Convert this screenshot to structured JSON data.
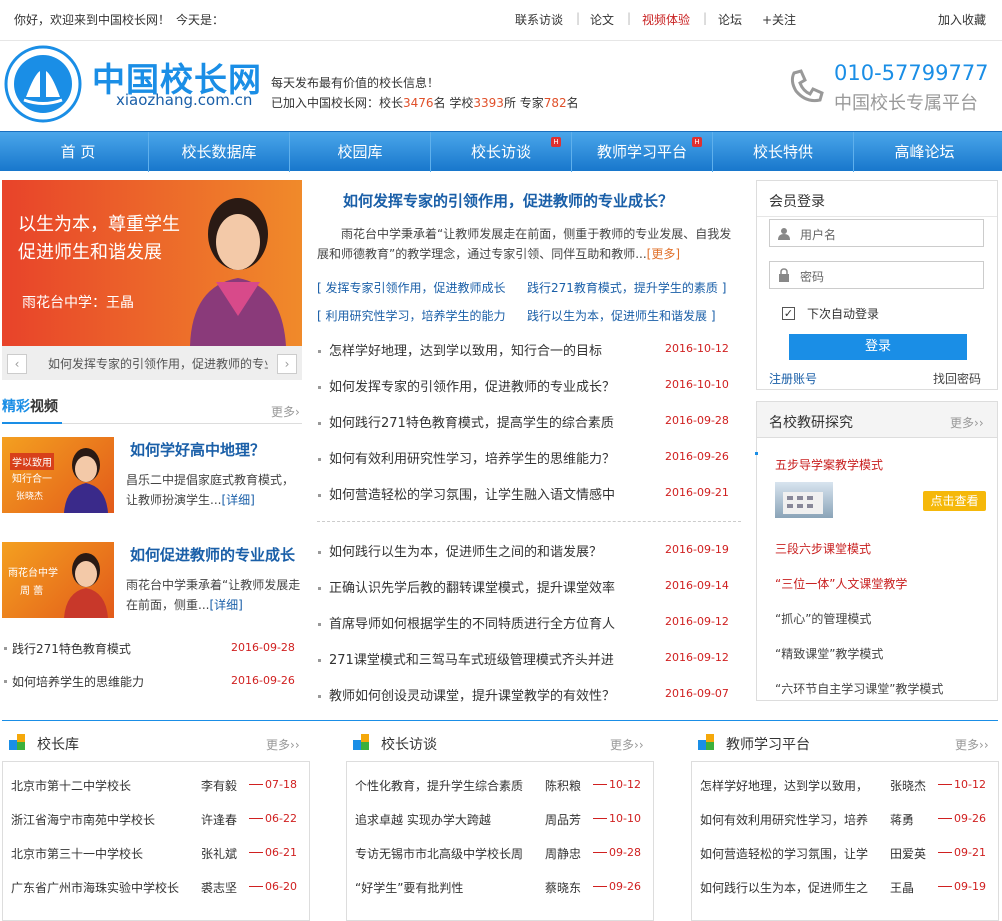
{
  "topbar": {
    "greeting": "你好，欢迎来到中国校长网！",
    "today": "今天是：",
    "links": [
      "联系访谈",
      "论文",
      "视频体验",
      "论坛"
    ],
    "follow": "+关注",
    "bookmark": "加入收藏"
  },
  "header": {
    "logo_cn": "中国校长网",
    "logo_en": "xiaozhang.com.cn",
    "seal_text": "中国校长网",
    "tagline": "每天发布最有价值的校长信息！",
    "stats_prefix": "已加入中国校长网：校长",
    "principals": "3476",
    "stats_mid1": "名 学校",
    "schools": "3393",
    "stats_mid2": "所 专家",
    "experts": "782",
    "stats_suffix": "名",
    "phone": "010-57799777",
    "platform": "中国校长专属平台"
  },
  "nav": [
    {
      "label": "首 页",
      "hot": false
    },
    {
      "label": "校长数据库",
      "hot": false
    },
    {
      "label": "校园库",
      "hot": false
    },
    {
      "label": "校长访谈",
      "hot": true
    },
    {
      "label": "教师学习平台",
      "hot": true
    },
    {
      "label": "校长特供",
      "hot": false
    },
    {
      "label": "高峰论坛",
      "hot": false
    }
  ],
  "hot_badge": "H",
  "banner": {
    "line1": "以生为本，尊重学生",
    "line2": "促进师生和谐发展",
    "caption": "雨花台中学：王晶",
    "ticker": "如何发挥专家的引领作用，促进教师的专业成长"
  },
  "video": {
    "title_a": "精彩",
    "title_b": "视频",
    "more": "更多",
    "items": [
      {
        "title": "如何学好高中地理？",
        "desc": "昌乐二中提倡家庭式教育模式，让教师扮演学生...",
        "detail": "[详细]",
        "thumb1": "学以致用",
        "thumb2": "知行合一",
        "thumb3": "张晓杰"
      },
      {
        "title": "如何促进教师的专业成长",
        "desc": "雨花台中学秉承着“让教师发展走在前面，侧重...",
        "detail": "[详细]",
        "thumb1": "雨花台中学",
        "thumb2": "周 蕾",
        "thumb3": ""
      }
    ],
    "list": [
      {
        "t": "践行271特色教育模式",
        "d": "2016-09-28"
      },
      {
        "t": "如何培养学生的思维能力",
        "d": "2016-09-26"
      }
    ]
  },
  "center": {
    "headline": "如何发挥专家的引领作用，促进教师的专业成长？",
    "summary": "雨花台中学秉承着“让教师发展走在前面，侧重于教师的专业发展、自我发展和师德教育”的教学理念，通过专家引领、同伴互助和教师...",
    "more": "[更多]",
    "quick": [
      "发挥专家引领作用，促进教师成长",
      "践行271教育模式，提升学生的素质",
      "利用研究性学习，培养学生的能力",
      "践行以生为本，促进师生和谐发展"
    ],
    "list1": [
      {
        "t": "怎样学好地理，达到学以致用，知行合一的目标",
        "d": "2016-10-12"
      },
      {
        "t": "如何发挥专家的引领作用，促进教师的专业成长？",
        "d": "2016-10-10"
      },
      {
        "t": "如何践行271特色教育模式，提高学生的综合素质",
        "d": "2016-09-28"
      },
      {
        "t": "如何有效利用研究性学习，培养学生的思维能力？",
        "d": "2016-09-26"
      },
      {
        "t": "如何营造轻松的学习氛围，让学生融入语文情感中",
        "d": "2016-09-21"
      }
    ],
    "list2": [
      {
        "t": "如何践行以生为本，促进师生之间的和谐发展？",
        "d": "2016-09-19"
      },
      {
        "t": "正确认识先学后教的翻转课堂模式，提升课堂效率",
        "d": "2016-09-14"
      },
      {
        "t": "首席导师如何根据学生的不同特质进行全方位育人",
        "d": "2016-09-12"
      },
      {
        "t": "271课堂模式和三驾马车式班级管理模式齐头并进",
        "d": "2016-09-12"
      },
      {
        "t": "教师如何创设灵动课堂，提升课堂教学的有效性？",
        "d": "2016-09-07"
      }
    ]
  },
  "login": {
    "title": "会员登录",
    "username_ph": "用户名",
    "password_ph": "密码",
    "remember": "下次自动登录",
    "submit": "登录",
    "register": "注册账号",
    "forgot": "找回密码"
  },
  "research": {
    "title": "名校教研探究",
    "more": "更多",
    "first": "五步导学案教学模式",
    "view": "点击查看",
    "items": [
      "三段六步课堂模式",
      "“三位一体”人文课堂教学",
      "“抓心”的管理模式",
      "“精致课堂”教学模式",
      "“六环节自主学习课堂”教学模式"
    ]
  },
  "bottom": [
    {
      "title": "校长库",
      "more": "更多",
      "rows": [
        {
          "t": "北京市第十二中学校长",
          "n": "李有毅",
          "d": "07-18"
        },
        {
          "t": "浙江省海宁市南苑中学校长",
          "n": "许逢春",
          "d": "06-22"
        },
        {
          "t": "北京市第三十一中学校长",
          "n": "张礼斌",
          "d": "06-21"
        },
        {
          "t": "广东省广州市海珠实验中学校长",
          "n": "裘志坚",
          "d": "06-20"
        }
      ]
    },
    {
      "title": "校长访谈",
      "more": "更多",
      "rows": [
        {
          "t": "个性化教育，提升学生综合素质",
          "n": "陈积粮",
          "d": "10-12"
        },
        {
          "t": "追求卓越 实现办学大跨越",
          "n": "周品芳",
          "d": "10-10"
        },
        {
          "t": "专访无锡市市北高级中学校长周",
          "n": "周静忠",
          "d": "09-28"
        },
        {
          "t": "“好学生”要有批判性",
          "n": "蔡晓东",
          "d": "09-26"
        }
      ]
    },
    {
      "title": "教师学习平台",
      "more": "更多",
      "rows": [
        {
          "t": "怎样学好地理，达到学以致用，",
          "n": "张晓杰",
          "d": "10-12"
        },
        {
          "t": "如何有效利用研究性学习，培养",
          "n": "蒋勇",
          "d": "09-26"
        },
        {
          "t": "如何营造轻松的学习氛围，让学",
          "n": "田爱英",
          "d": "09-21"
        },
        {
          "t": "如何践行以生为本，促进师生之",
          "n": "王晶",
          "d": "09-19"
        }
      ]
    }
  ],
  "colors": {
    "nav": "#1877cc",
    "accent": "#c81e1e",
    "link": "#1a5fa8",
    "badge": "#e03030",
    "button": "#1a8ee6"
  }
}
